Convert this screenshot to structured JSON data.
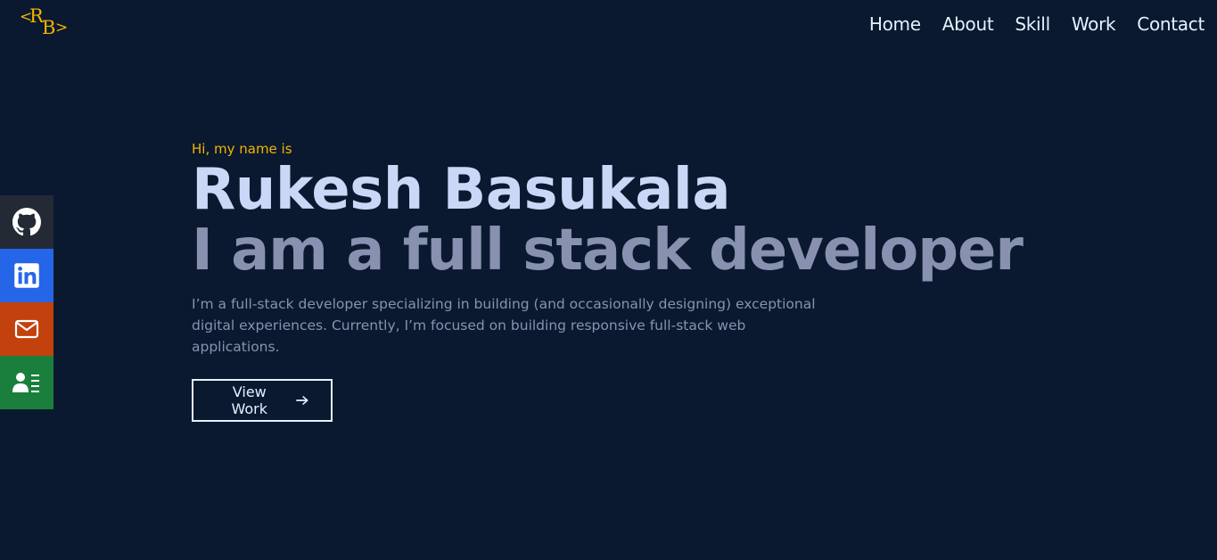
{
  "logo": {
    "left": "<",
    "r": "R",
    "b": "B",
    "right": ">"
  },
  "nav": {
    "items": [
      "Home",
      "About",
      "Skill",
      "Work",
      "Contact"
    ]
  },
  "social": {
    "items": [
      {
        "name": "github",
        "icon": "github-icon",
        "color": "#232a36"
      },
      {
        "name": "linkedin",
        "icon": "linkedin-icon",
        "color": "#2566e8"
      },
      {
        "name": "email",
        "icon": "mail-icon",
        "color": "#c2410c"
      },
      {
        "name": "resume",
        "icon": "contact-card-icon",
        "color": "#1a7f3c"
      }
    ]
  },
  "hero": {
    "greeting": "Hi, my name is",
    "name": "Rukesh Basukala",
    "tagline": "I am a full stack developer",
    "description": "I’m a full-stack developer specializing in building (and occasionally designing) exceptional digital experiences. Currently, I’m focused on building responsive full-stack web applications.",
    "cta_label": "View Work",
    "cta_icon": "arrow-right-icon"
  },
  "colors": {
    "background": "#0a192f",
    "accent": "#f4b400",
    "heading": "#ccd6f6",
    "muted": "#8892b0"
  }
}
